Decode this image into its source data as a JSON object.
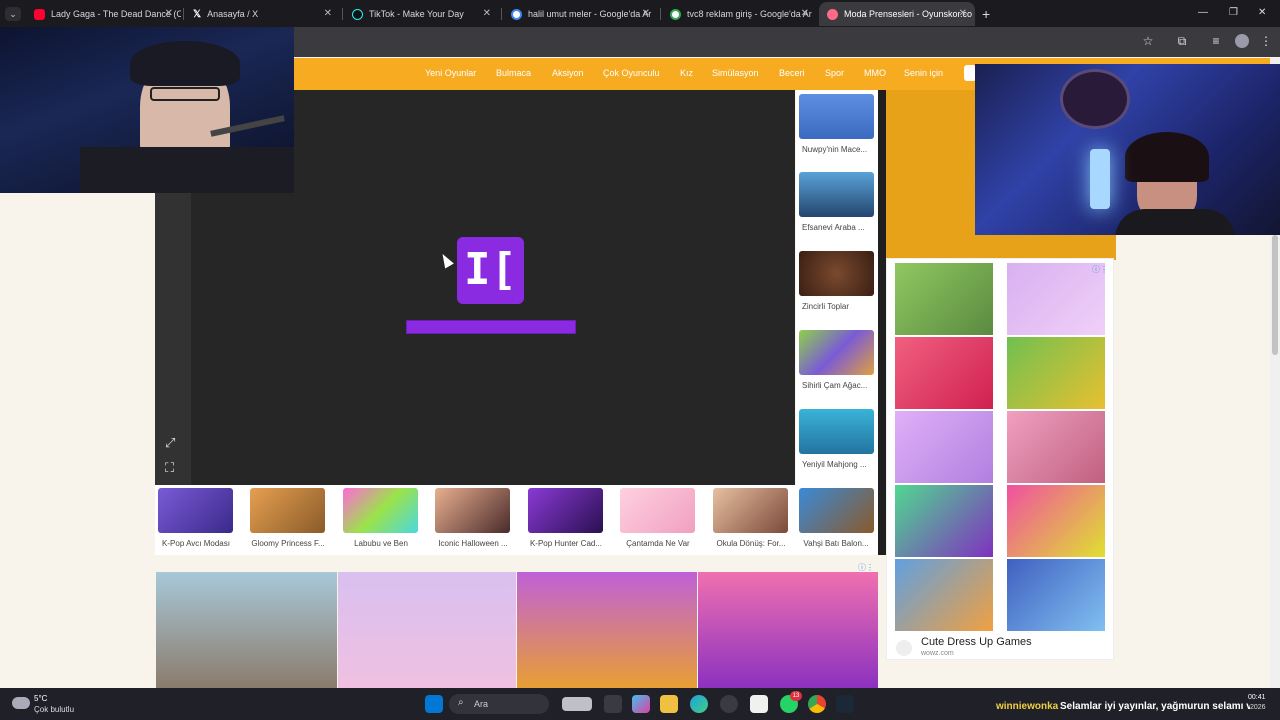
{
  "browser": {
    "tabs": [
      {
        "title": "Lady Gaga - The Dead Dance (O",
        "favicon": "youtube-icon",
        "color": "#ff0033"
      },
      {
        "title": "Anasayfa / X",
        "favicon": "x-icon",
        "color": "#ffffff"
      },
      {
        "title": "TikTok - Make Your Day",
        "favicon": "tiktok-icon",
        "color": "#ffffff"
      },
      {
        "title": "halil umut meler - Google'da Ar",
        "favicon": "google-icon",
        "color": "#ffffff"
      },
      {
        "title": "tvc8 reklam giriş - Google'da Ar",
        "favicon": "google-icon",
        "color": "#ffffff"
      },
      {
        "title": "Moda Prensesleri - Oyunskor.co",
        "favicon": "oyunskor-icon",
        "color": "#ff6a8a"
      }
    ],
    "new_tab": "+",
    "window_controls": {
      "minimize": "—",
      "maximize": "❐",
      "close": "✕"
    }
  },
  "site_nav": {
    "items": [
      "Yeni Oyunlar",
      "Bulmaca",
      "Aksiyon",
      "Çok Oyunculu",
      "Kız",
      "Simülasyon",
      "Beceri",
      "Spor",
      "MMO",
      "Senin için"
    ],
    "accent": "#f6ab21"
  },
  "game": {
    "logo_text": "I[",
    "loading_color": "#8a2be2"
  },
  "sidebar_games": [
    {
      "label": "Nuwpy'nin Mace...",
      "color": "#4c7fd1"
    },
    {
      "label": "Efsanevi Araba ...",
      "color": "#2a6ba8"
    },
    {
      "label": "Zincirli Toplar",
      "color": "#4a2a1e"
    },
    {
      "label": "Sihirli Çam Ağac...",
      "color": "#7a5bd6"
    },
    {
      "label": "Yeniyil Mahjong ...",
      "color": "#2ea3c6"
    }
  ],
  "bottom_games": [
    {
      "label": "K-Pop Avcı Modası",
      "color": "#6a4ec4"
    },
    {
      "label": "Gloomy Princess F...",
      "color": "#c88b3a"
    },
    {
      "label": "Labubu ve Ben",
      "color": "#9bd34a"
    },
    {
      "label": "Iconic Halloween ...",
      "color": "#d5a08a"
    },
    {
      "label": "K-Pop Hunter Cad...",
      "color": "#5a2a8a"
    },
    {
      "label": "Çantamda Ne Var",
      "color": "#f4c6d6"
    },
    {
      "label": "Okula Dönüş: For...",
      "color": "#c9a48a"
    },
    {
      "label": "Vahşi Batı Balon...",
      "color": "#1e5fa8"
    }
  ],
  "ad": {
    "title": "Cute Dress Up Games",
    "domain": "wowz.com"
  },
  "taskbar": {
    "weather_temp": "5°C",
    "weather_desc": "Çok bulutlu",
    "search_placeholder": "Ara",
    "time": "00:41",
    "date": "2026",
    "badge": "13"
  },
  "chat": {
    "user": "winniewonka",
    "message": "Selamlar iyi yayınlar, yağmurun selamı var"
  }
}
